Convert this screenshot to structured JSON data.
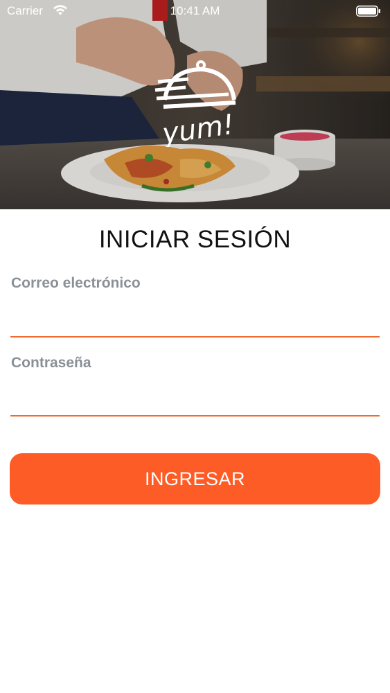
{
  "status_bar": {
    "carrier": "Carrier",
    "time": "10:41 AM",
    "wifi_icon": "wifi-icon",
    "battery_icon": "battery-icon"
  },
  "hero": {
    "image": "chef-plating-food-photo",
    "logo_icon": "yum-cloche-logo",
    "logo_text": "yum!"
  },
  "login": {
    "title": "INICIAR SESIÓN",
    "email_label": "Correo electrónico",
    "email_value": "",
    "password_label": "Contraseña",
    "password_value": "",
    "submit_label": "INGRESAR"
  },
  "colors": {
    "accent": "#fe5c26",
    "underline": "#f0692f",
    "label": "#8a9097",
    "title": "#111111"
  }
}
